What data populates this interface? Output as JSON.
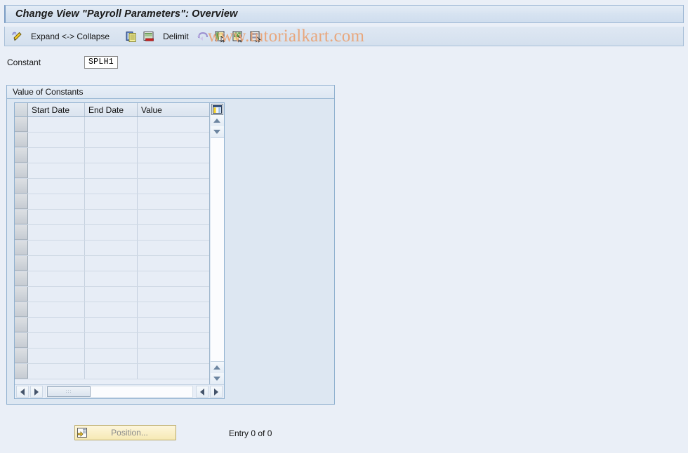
{
  "window": {
    "title": "Change View \"Payroll Parameters\": Overview"
  },
  "toolbar": {
    "items": [
      {
        "name": "display-change-icon",
        "icon": "pencil-icon",
        "label": ""
      },
      {
        "name": "expand-collapse",
        "icon": "",
        "label": "Expand <-> Collapse"
      },
      {
        "name": "copy-as",
        "icon": "copy-icon",
        "label": ""
      },
      {
        "name": "delete-row",
        "icon": "delete-row-icon",
        "label": ""
      },
      {
        "name": "delimit",
        "icon": "",
        "label": "Delimit"
      },
      {
        "name": "undo",
        "icon": "undo-icon",
        "label": ""
      },
      {
        "name": "select-all",
        "icon": "select-block-icon",
        "label": ""
      },
      {
        "name": "deselect-all",
        "icon": "deselect-block-icon",
        "label": ""
      },
      {
        "name": "select-detail",
        "icon": "detail-icon",
        "label": ""
      }
    ]
  },
  "constant": {
    "label": "Constant",
    "value": "SPLH1"
  },
  "group": {
    "title": "Value of Constants"
  },
  "table": {
    "columns": [
      "Start Date",
      "End Date",
      "Value"
    ],
    "rows": [],
    "empty_row_count": 17,
    "config_icon": "table-settings-icon"
  },
  "footer": {
    "position_button_label": "Position...",
    "position_button_icon": "position-icon",
    "entry_status": "Entry 0 of 0"
  },
  "watermark": {
    "text": "www.tutorialkart.com",
    "color": "#e8a77d"
  },
  "colors": {
    "background": "#eaeff7",
    "panel": "#dde7f2",
    "border": "#8fb0cf",
    "grid_cell": "#e7edf6",
    "button_yellow": "#f6e9b4"
  }
}
